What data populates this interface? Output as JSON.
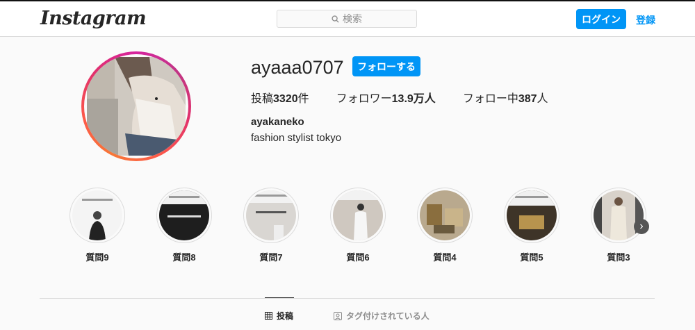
{
  "header": {
    "logo": "Instagram",
    "search_placeholder": "検索",
    "login_label": "ログイン",
    "signup_label": "登録"
  },
  "profile": {
    "username": "ayaaa0707",
    "follow_label": "フォローする",
    "stats": {
      "posts_prefix": "投稿",
      "posts_count": "3320",
      "posts_suffix": "件",
      "followers_prefix": "フォロワー",
      "followers_count": "13.9万",
      "followers_suffix": "人",
      "following_prefix": "フォロー中",
      "following_count": "387",
      "following_suffix": "人"
    },
    "full_name": "ayakaneko",
    "bio": "fashion stylist tokyo"
  },
  "highlights": [
    {
      "label": "質問9"
    },
    {
      "label": "質問8"
    },
    {
      "label": "質問7"
    },
    {
      "label": "質問6"
    },
    {
      "label": "質問4"
    },
    {
      "label": "質問5"
    },
    {
      "label": "質問3"
    }
  ],
  "tabs": {
    "posts_label": "投稿",
    "tagged_label": "タグ付けされている人"
  },
  "colors": {
    "accent": "#0095f6",
    "text": "#262626",
    "muted": "#8e8e8e",
    "border": "#dbdbdb"
  }
}
